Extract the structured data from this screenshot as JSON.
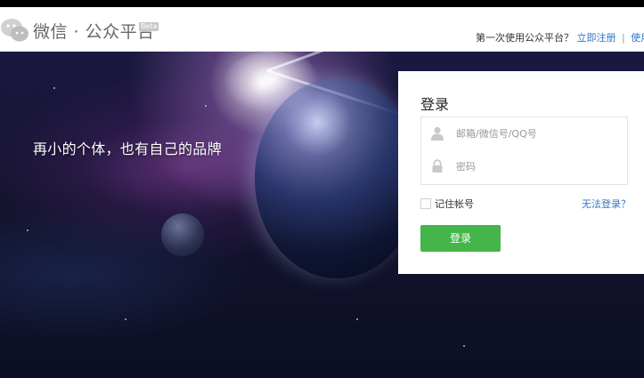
{
  "header": {
    "brand": "微信 · 公众平台",
    "beta": "Beta",
    "prompt": "第一次使用公众平台？",
    "register_link": "立即注册",
    "separator": "|",
    "help_link": "使用帮助"
  },
  "hero": {
    "slogan": "再小的个体，也有自己的品牌"
  },
  "login": {
    "title": "登录",
    "account_placeholder": "邮箱/微信号/QQ号",
    "password_placeholder": "密码",
    "remember_label": "记住帐号",
    "cant_login": "无法登录？",
    "submit_label": "登录"
  },
  "icons": {
    "logo": "wechat-logo-icon",
    "user": "user-icon",
    "lock": "lock-icon"
  },
  "colors": {
    "accent_green": "#44b549",
    "link_blue": "#2e77c8"
  }
}
